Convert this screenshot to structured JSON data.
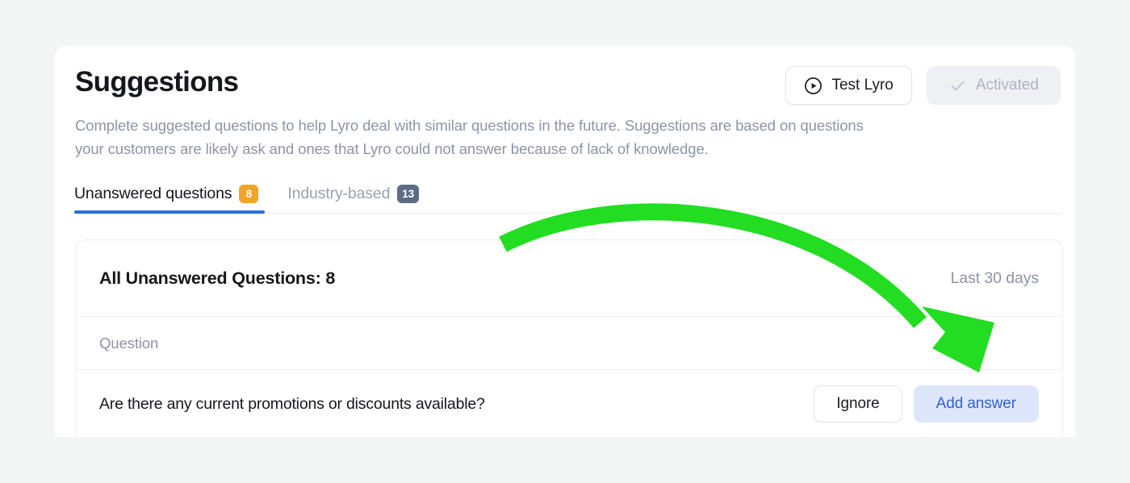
{
  "page": {
    "title": "Suggestions",
    "description": "Complete suggested questions to help Lyro deal with similar questions in the future. Suggestions are based on questions your customers are likely ask and ones that Lyro could not answer because of lack of knowledge."
  },
  "header_actions": {
    "test_lyro_label": "Test Lyro",
    "test_lyro_icon": "play-circle-icon",
    "activated_label": "Activated",
    "activated_icon": "check-icon"
  },
  "tabs": [
    {
      "label": "Unanswered questions",
      "badge": "8",
      "badge_color": "#f2a42a",
      "active": true
    },
    {
      "label": "Industry-based",
      "badge": "13",
      "badge_color": "#5d6b85",
      "active": false
    }
  ],
  "table": {
    "summary_title": "All Unanswered Questions: 8",
    "period_label": "Last 30 days",
    "columns": [
      "Question"
    ],
    "rows": [
      {
        "question": "Are there any current promotions or discounts available?",
        "ignore_label": "Ignore",
        "add_answer_label": "Add answer"
      }
    ]
  },
  "annotation": {
    "arrow_color": "#22dd22",
    "arrow_shape": "curved-down-right-arrow"
  },
  "colors": {
    "page_background": "#f3f6f5",
    "card_background": "#ffffff",
    "active_tab_underline": "#2b6fd6",
    "add_answer_background": "#dde6fb",
    "add_answer_text": "#3360d8"
  }
}
